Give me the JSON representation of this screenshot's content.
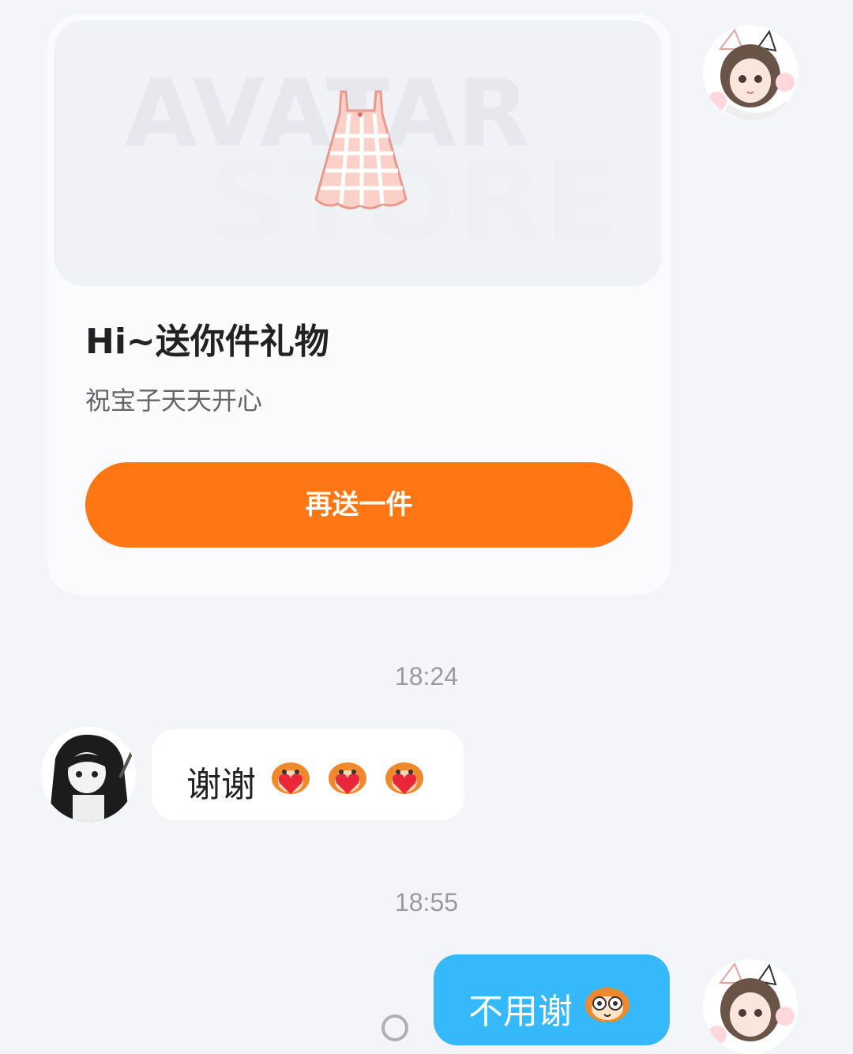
{
  "gift_card": {
    "watermark_line1": "AVATAR",
    "watermark_line2": "STORE",
    "title": "Hi~送你件礼物",
    "subtitle": "祝宝子天天开心",
    "button_label": "再送一件",
    "button_color": "#ff7715"
  },
  "messages": [
    {
      "type": "timestamp",
      "text": "18:24"
    },
    {
      "type": "incoming",
      "text": "谢谢",
      "emoji": [
        "heart-monkey-icon",
        "heart-monkey-icon",
        "heart-monkey-icon"
      ]
    },
    {
      "type": "timestamp",
      "text": "18:55"
    },
    {
      "type": "outgoing",
      "text": "不用谢",
      "emoji": [
        "monkey-face-icon"
      ],
      "bubble_color": "#36b9fb"
    }
  ]
}
